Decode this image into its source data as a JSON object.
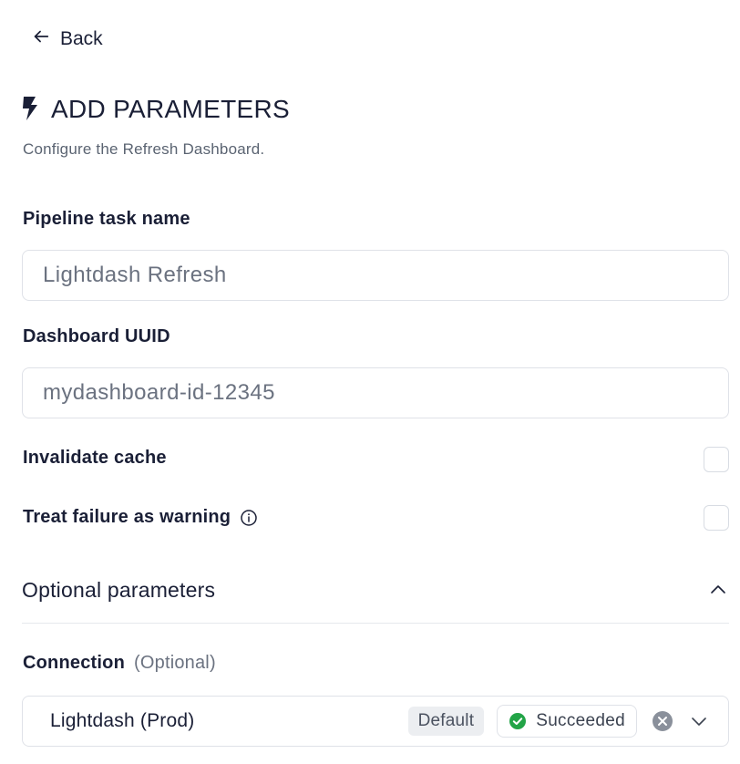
{
  "nav": {
    "back_label": "Back",
    "back_icon": "arrow-left-icon"
  },
  "header": {
    "icon": "lightning-bolt-icon",
    "title": "ADD PARAMETERS",
    "subtitle": "Configure the Refresh Dashboard."
  },
  "form": {
    "task_name": {
      "label": "Pipeline task name",
      "value": "",
      "placeholder": "Lightdash Refresh"
    },
    "dashboard_uuid": {
      "label": "Dashboard UUID",
      "value": "",
      "placeholder": "mydashboard-id-12345"
    },
    "invalidate_cache": {
      "label": "Invalidate cache",
      "checked": false
    },
    "treat_failure_as_warning": {
      "label": "Treat failure as warning",
      "checked": false,
      "info_icon": "info-circle-icon"
    }
  },
  "optional_section": {
    "title": "Optional parameters",
    "expanded": true,
    "toggle_icon": "chevron-up-icon",
    "connection": {
      "label": "Connection",
      "optional_tag": "(Optional)",
      "selected": "Lightdash (Prod)",
      "default_badge": "Default",
      "status": "Succeeded",
      "status_color": "#22a447",
      "clear_icon": "clear-circle-icon",
      "dropdown_icon": "chevron-down-icon"
    }
  },
  "colors": {
    "text_primary": "#1a1f36",
    "text_muted": "#5b6472",
    "border": "#dfe2e8",
    "success": "#22a447"
  }
}
